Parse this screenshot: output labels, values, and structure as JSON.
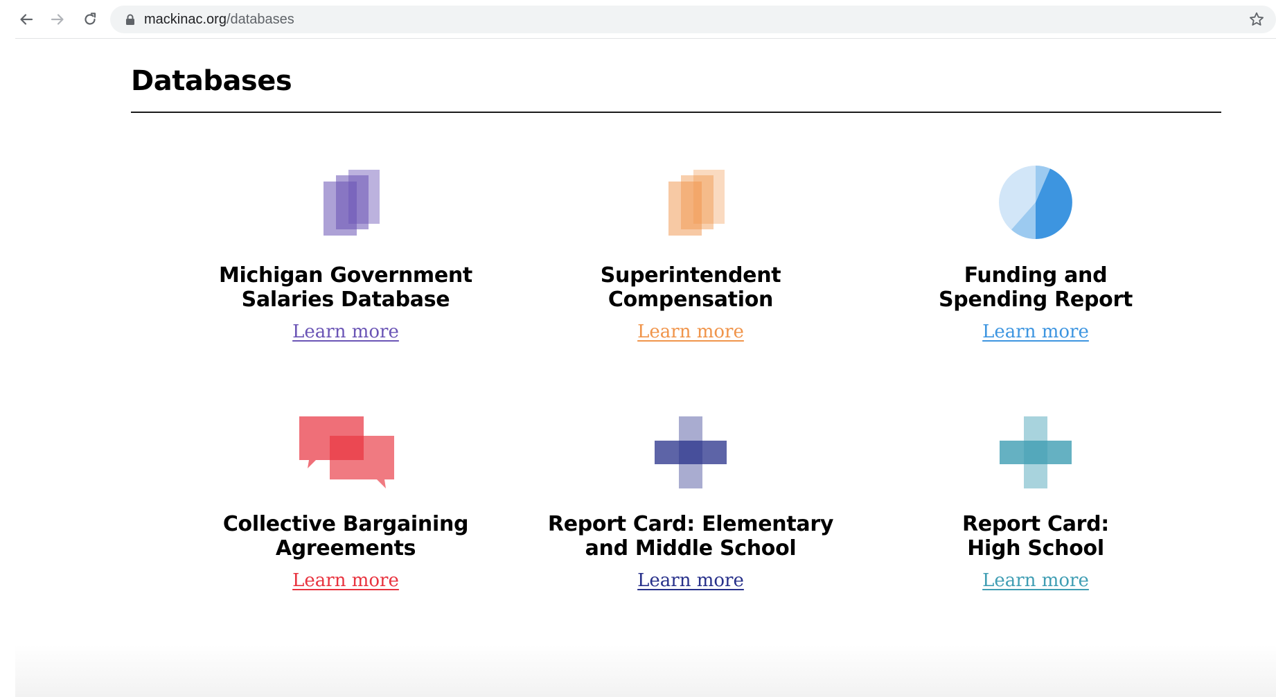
{
  "browser": {
    "url_host": "mackinac.org",
    "url_path": "/databases",
    "icons": {
      "back": "back-arrow-icon",
      "forward": "forward-arrow-icon",
      "reload": "reload-icon",
      "lock": "lock-icon",
      "bookmark": "star-icon"
    }
  },
  "page": {
    "title": "Databases"
  },
  "cards": [
    {
      "title_line1": "Michigan Government",
      "title_line2": "Salaries Database",
      "link": "Learn more",
      "color": "#6a54b5",
      "icon": "stacked-documents-icon"
    },
    {
      "title_line1": "Superintendent",
      "title_line2": "Compensation",
      "link": "Learn more",
      "color": "#f0944a",
      "icon": "stacked-documents-icon"
    },
    {
      "title_line1": "Funding and",
      "title_line2": "Spending Report",
      "link": "Learn more",
      "color": "#3d95e0",
      "icon": "pie-chart-icon"
    },
    {
      "title_line1": "Collective Bargaining",
      "title_line2": "Agreements",
      "link": "Learn more",
      "color": "#e8323e",
      "icon": "speech-bubbles-icon"
    },
    {
      "title_line1": "Report Card: Elementary",
      "title_line2": "and Middle School",
      "link": "Learn more",
      "color": "#27308a",
      "icon": "plus-cross-icon"
    },
    {
      "title_line1": "Report Card:",
      "title_line2": "High School",
      "link": "Learn more",
      "color": "#3f9db3",
      "icon": "plus-cross-icon"
    }
  ]
}
